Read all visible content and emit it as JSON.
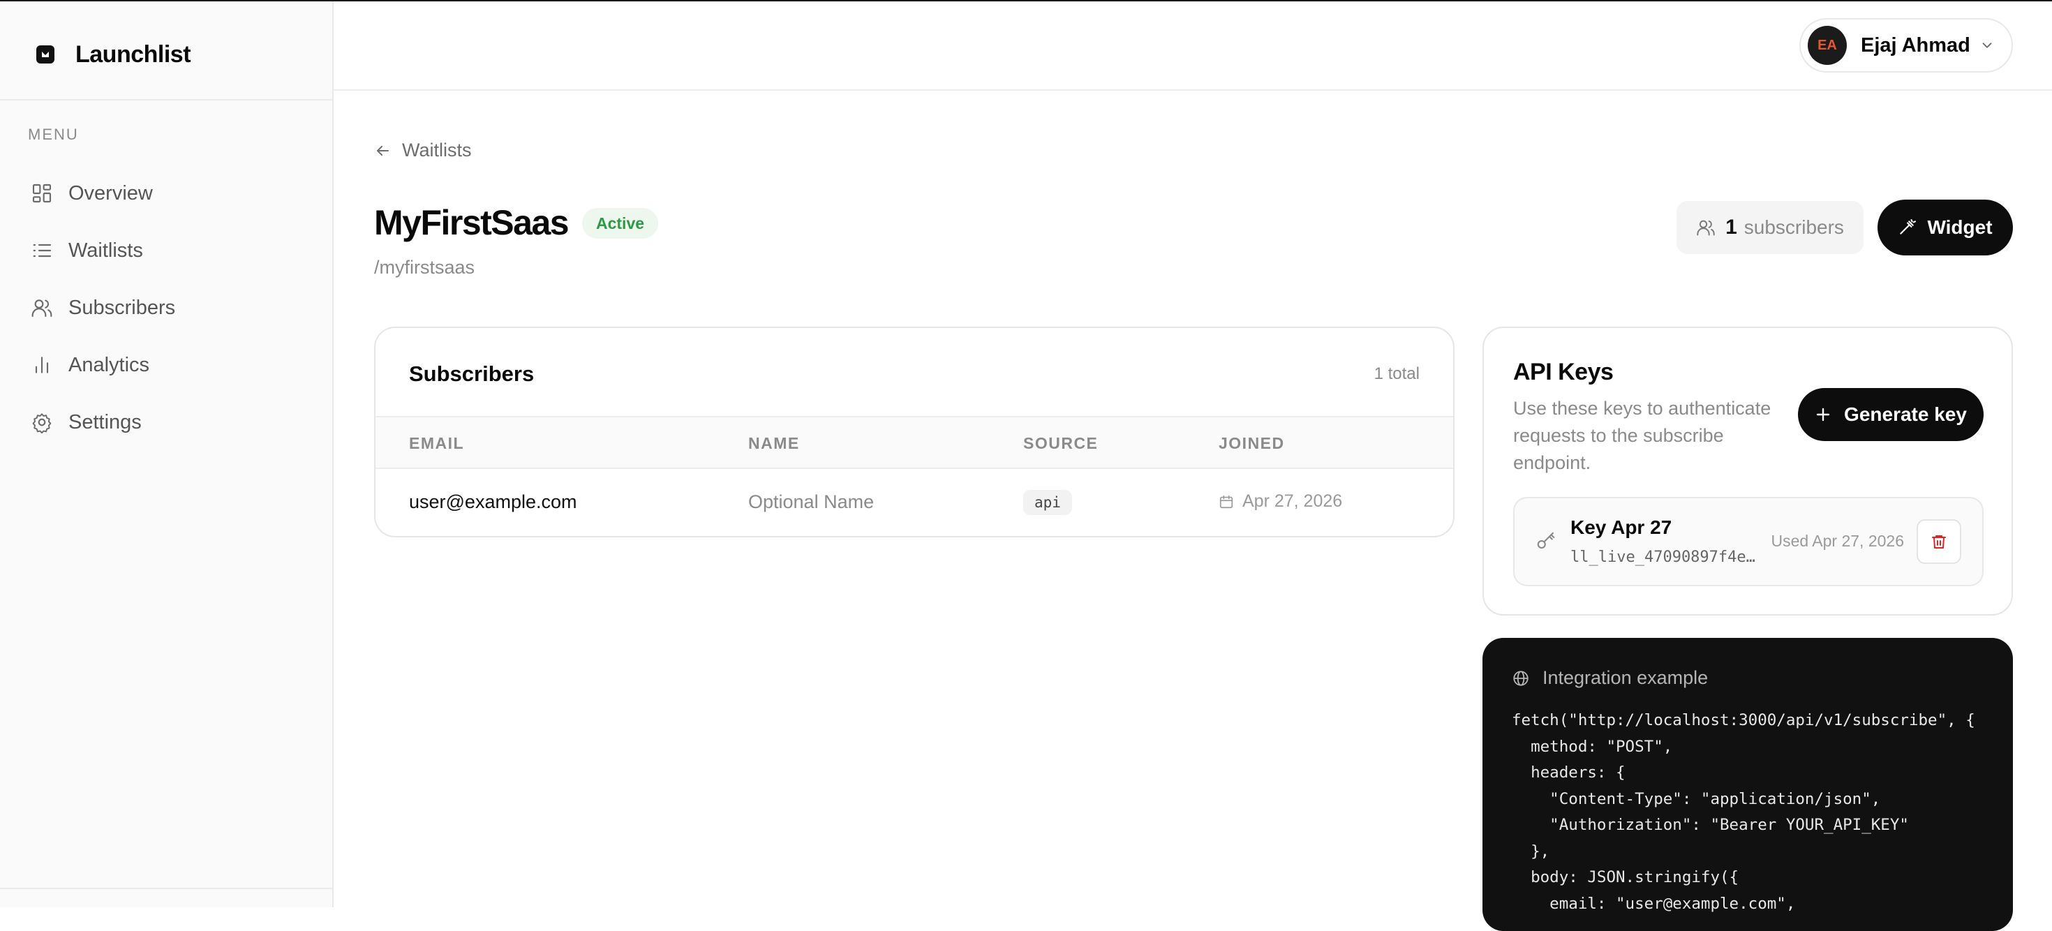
{
  "sidebar": {
    "brand": "Launchlist",
    "menu_label": "MENU",
    "items": [
      {
        "label": "Overview",
        "icon": "dashboard-icon"
      },
      {
        "label": "Waitlists",
        "icon": "list-icon"
      },
      {
        "label": "Subscribers",
        "icon": "users-icon"
      },
      {
        "label": "Analytics",
        "icon": "bar-chart-icon"
      },
      {
        "label": "Settings",
        "icon": "gear-icon"
      }
    ]
  },
  "header": {
    "user": {
      "initials": "EA",
      "name": "Ejaj Ahmad"
    }
  },
  "page": {
    "back_label": "Waitlists",
    "title": "MyFirstSaas",
    "status": "Active",
    "slug": "/myfirstsaas",
    "subscriber_count": "1",
    "subscriber_suffix": "subscribers",
    "widget_label": "Widget"
  },
  "subscribers": {
    "title": "Subscribers",
    "total": "1 total",
    "columns": [
      "EMAIL",
      "NAME",
      "SOURCE",
      "JOINED"
    ],
    "rows": [
      {
        "email": "user@example.com",
        "name": "Optional Name",
        "source": "api",
        "joined": "Apr 27, 2026"
      }
    ]
  },
  "api_keys": {
    "title": "API Keys",
    "description": "Use these keys to authenticate requests to the subscribe endpoint.",
    "generate_label": "Generate key",
    "keys": [
      {
        "name": "Key Apr 27",
        "token": "ll_live_47090897f4e…",
        "used": "Used Apr 27, 2026"
      }
    ]
  },
  "integration": {
    "title": "Integration example",
    "code": "fetch(\"http://localhost:3000/api/v1/subscribe\", {\n  method: \"POST\",\n  headers: {\n    \"Content-Type\": \"application/json\",\n    \"Authorization\": \"Bearer YOUR_API_KEY\"\n  },\n  body: JSON.stringify({\n    email: \"user@example.com\","
  },
  "colors": {
    "accent": "#0d0d0d",
    "status_green": "#2e9a45",
    "danger": "#dc2626",
    "avatar_text": "#e5582e"
  }
}
